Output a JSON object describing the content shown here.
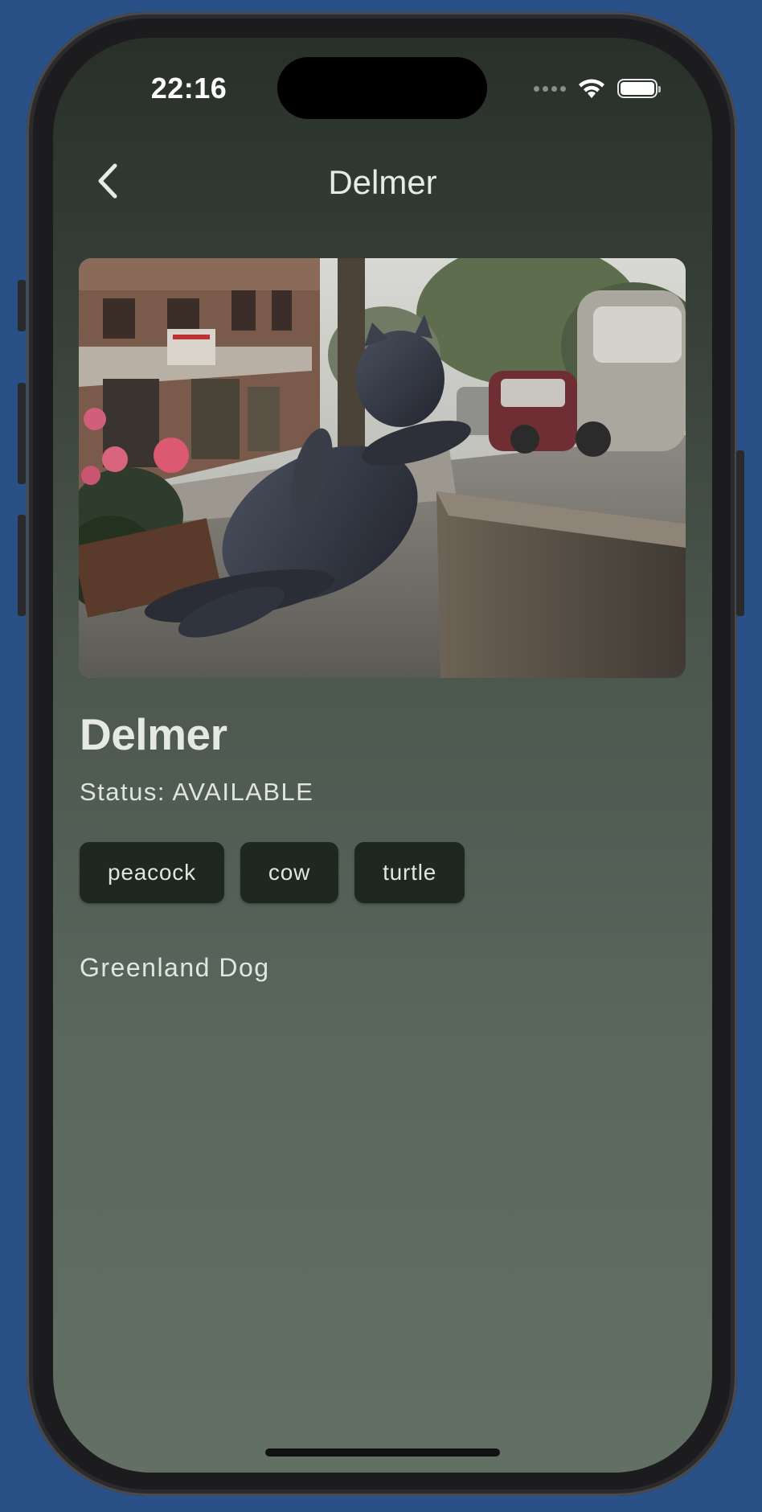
{
  "status_bar": {
    "time": "22:16"
  },
  "nav": {
    "title": "Delmer",
    "back_icon": "chevron-left-icon"
  },
  "pet": {
    "name": "Delmer",
    "status": "Status: AVAILABLE",
    "tags": [
      "peacock",
      "cow",
      "turtle"
    ],
    "breed": "Greenland Dog",
    "photo_alt": "Bronze statue of a cat reclining against a curb on a city street"
  },
  "colors": {
    "background": "#2a5088",
    "screen_top": "#283029",
    "screen_bottom": "#627064",
    "tag_bg": "#1e2720",
    "text": "#e4e9e5"
  }
}
